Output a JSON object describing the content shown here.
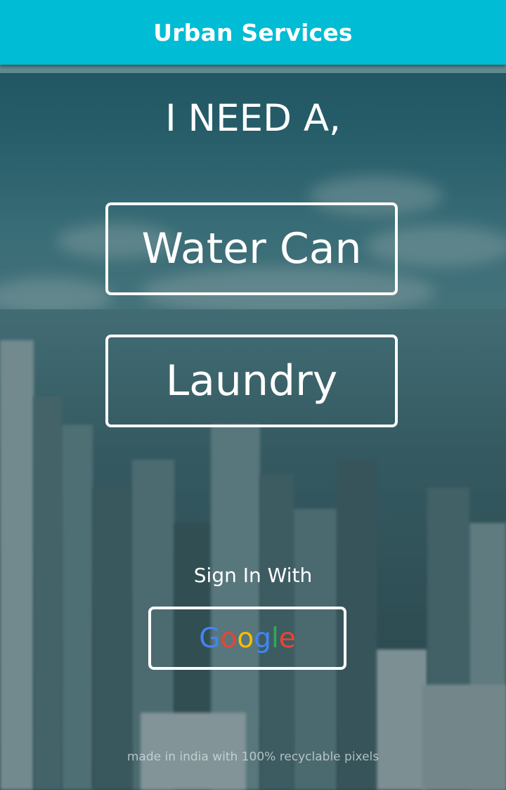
{
  "header": {
    "title": "Urban Services"
  },
  "main": {
    "headline": "I NEED A,",
    "services": [
      {
        "label": "Water Can"
      },
      {
        "label": "Laundry"
      }
    ]
  },
  "signin": {
    "label": "Sign In With",
    "google": {
      "letters": [
        "G",
        "o",
        "o",
        "g",
        "l",
        "e"
      ],
      "colors": [
        "#4285f4",
        "#ea4335",
        "#fbbc05",
        "#4285f4",
        "#34a853",
        "#ea4335"
      ]
    }
  },
  "footer": {
    "text": "made in india with 100% recyclable pixels"
  },
  "colors": {
    "header": "#00bcd4",
    "text": "#ffffff"
  }
}
